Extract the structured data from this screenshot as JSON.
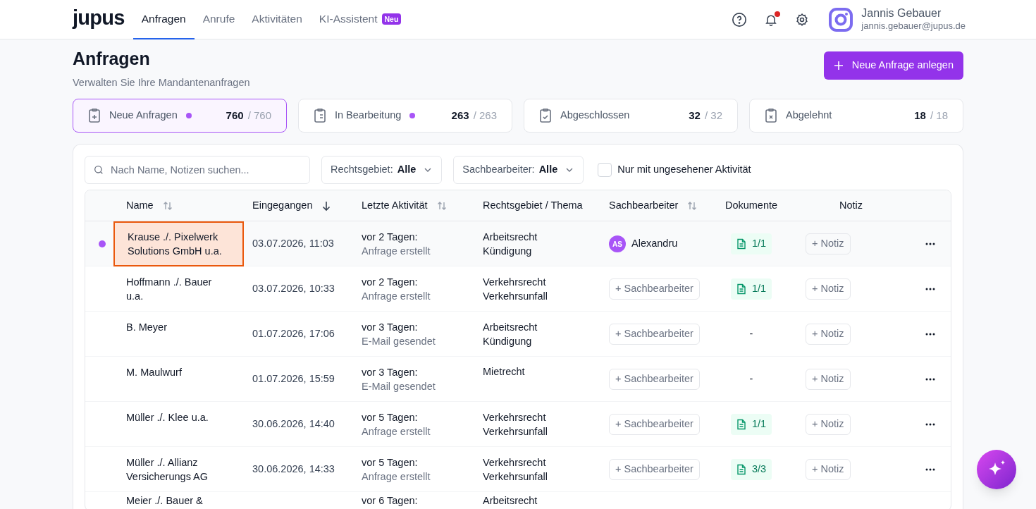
{
  "header": {
    "logo": "jupus",
    "nav": [
      {
        "label": "Anfragen",
        "selected": true
      },
      {
        "label": "Anrufe",
        "selected": false
      },
      {
        "label": "Aktivitäten",
        "selected": false
      },
      {
        "label": "KI-Assistent",
        "selected": false,
        "badge": "Neu"
      }
    ],
    "notifications_unread": true,
    "user": {
      "name": "Jannis Gebauer",
      "email": "jannis.gebauer@jupus.de"
    }
  },
  "page": {
    "title": "Anfragen",
    "subtitle": "Verwalten Sie Ihre Mandantenanfragen",
    "primary_button": "Neue Anfrage anlegen"
  },
  "status_tabs": [
    {
      "kind": "new",
      "label": "Neue Anfragen",
      "selected": true,
      "unseen": true,
      "count": "760",
      "total": "/ 760"
    },
    {
      "kind": "progress",
      "label": "In Bearbeitung",
      "selected": false,
      "unseen": true,
      "count": "263",
      "total": "/ 263"
    },
    {
      "kind": "done",
      "label": "Abgeschlossen",
      "selected": false,
      "unseen": false,
      "count": "32",
      "total": "/ 32"
    },
    {
      "kind": "rejected",
      "label": "Abgelehnt",
      "selected": false,
      "unseen": false,
      "count": "18",
      "total": "/ 18"
    }
  ],
  "filters": {
    "search_placeholder": "Nach Name, Notizen suchen...",
    "dropdowns": [
      {
        "label": "Rechtsgebiet:",
        "value": "Alle"
      },
      {
        "label": "Sachbearbeiter:",
        "value": "Alle"
      }
    ],
    "unseen_only": {
      "label": "Nur mit ungesehener Aktivität",
      "checked": false
    }
  },
  "table": {
    "columns": [
      {
        "label": "Name",
        "sortable": true,
        "sorted": false
      },
      {
        "label": "Eingegangen",
        "sortable": true,
        "sorted": true
      },
      {
        "label": "Letzte Aktivität",
        "sortable": true,
        "sorted": false
      },
      {
        "label": "Rechtsgebiet / Thema",
        "sortable": false,
        "sorted": false
      },
      {
        "label": "Sachbearbeiter",
        "sortable": true,
        "sorted": false
      },
      {
        "label": "Dokumente",
        "sortable": false,
        "sorted": false
      },
      {
        "label": "Notiz",
        "sortable": false,
        "sorted": false
      }
    ],
    "rows": [
      {
        "unseen": true,
        "selected": true,
        "name": "Krause ./. Pixelwerk Solutions GmbH u.a.",
        "received": "03.07.2026, 11:03",
        "activity_when": "vor 2 Tagen:",
        "activity_what": "Anfrage erstellt",
        "area": "Arbeitsrecht",
        "topic": "Kündigung",
        "assignee": {
          "initials": "AS",
          "name": "Alexandru"
        },
        "documents": "1/1",
        "note_button": "+ Notiz"
      },
      {
        "unseen": false,
        "selected": false,
        "name": "Hoffmann ./. Bauer u.a.",
        "received": "03.07.2026, 10:33",
        "activity_when": "vor 2 Tagen:",
        "activity_what": "Anfrage erstellt",
        "area": "Verkehrsrecht",
        "topic": "Verkehrsunfall",
        "assign_button": "+ Sachbearbeiter",
        "documents": "1/1",
        "note_button": "+ Notiz"
      },
      {
        "unseen": false,
        "selected": false,
        "name": "B. Meyer",
        "received": "01.07.2026, 17:06",
        "activity_when": "vor 3 Tagen:",
        "activity_what": "E-Mail gesendet",
        "area": "Arbeitsrecht",
        "topic": "Kündigung",
        "assign_button": "+ Sachbearbeiter",
        "no_documents": "-",
        "note_button": "+ Notiz"
      },
      {
        "unseen": false,
        "selected": false,
        "name": "M. Maulwurf",
        "received": "01.07.2026, 15:59",
        "activity_when": "vor 3 Tagen:",
        "activity_what": "E-Mail gesendet",
        "area": "Mietrecht",
        "assign_button": "+ Sachbearbeiter",
        "no_documents": "-",
        "note_button": "+ Notiz"
      },
      {
        "unseen": false,
        "selected": false,
        "name": "Müller ./. Klee u.a.",
        "received": "30.06.2026, 14:40",
        "activity_when": "vor 5 Tagen:",
        "activity_what": "Anfrage erstellt",
        "area": "Verkehrsrecht",
        "topic": "Verkehrsunfall",
        "assign_button": "+ Sachbearbeiter",
        "documents": "1/1",
        "note_button": "+ Notiz"
      },
      {
        "unseen": false,
        "selected": false,
        "name": "Müller ./. Allianz Versicherungs AG",
        "received": "30.06.2026, 14:33",
        "activity_when": "vor 5 Tagen:",
        "activity_what": "Anfrage erstellt",
        "area": "Verkehrsrecht",
        "topic": "Verkehrsunfall",
        "assign_button": "+ Sachbearbeiter",
        "documents": "3/3",
        "note_button": "+ Notiz"
      },
      {
        "unseen": false,
        "selected": false,
        "name": "Meier ./. Bauer &",
        "activity_when": "vor 6 Tagen:",
        "area": "Arbeitsrecht"
      }
    ]
  }
}
